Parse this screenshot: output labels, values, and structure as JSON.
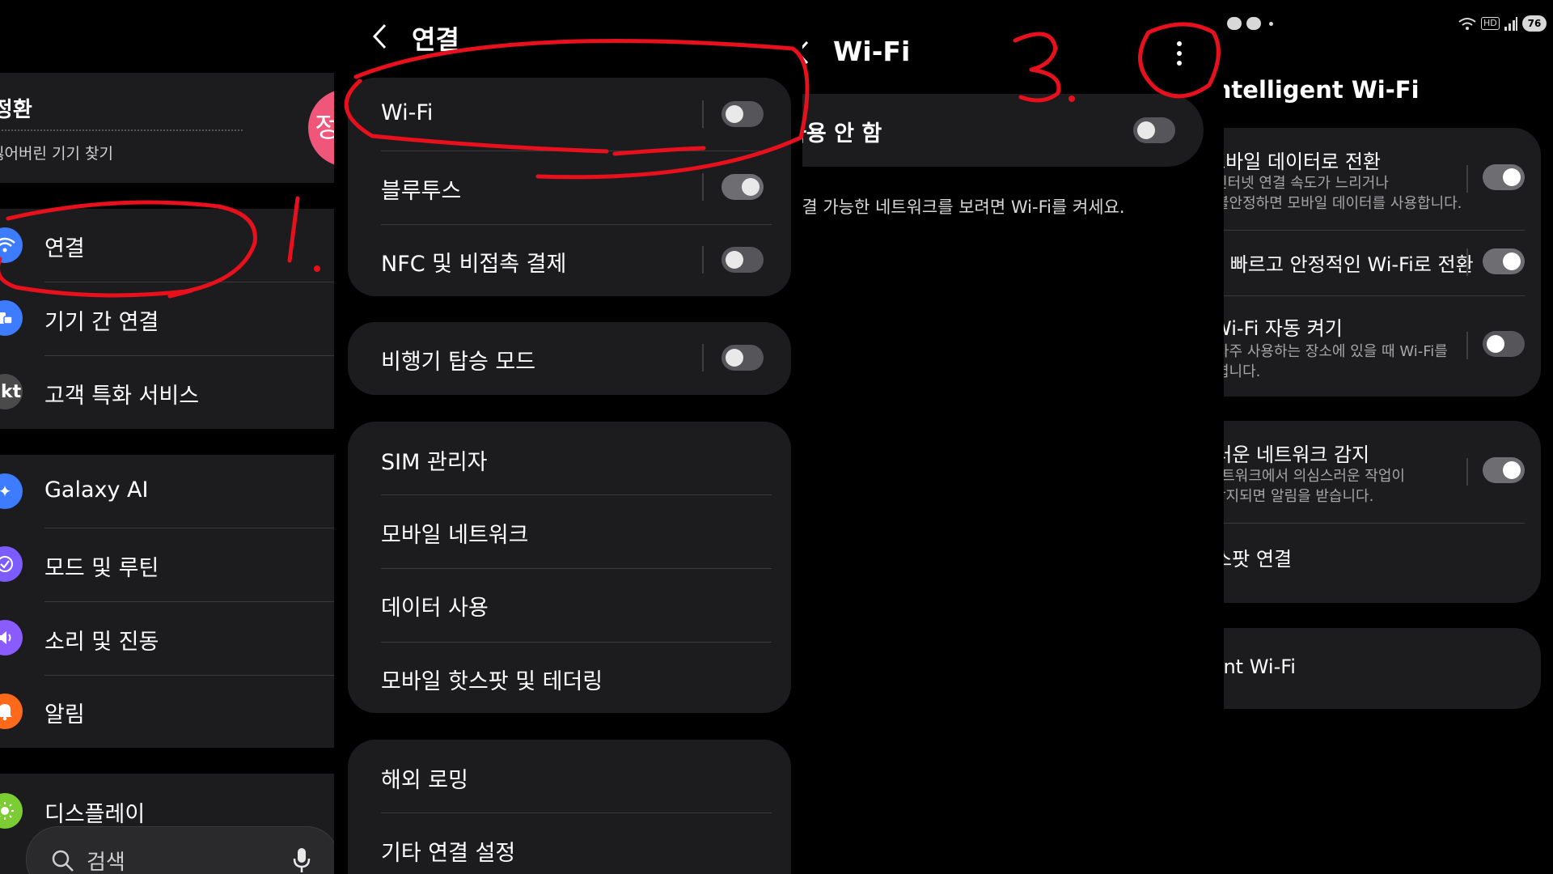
{
  "panel1": {
    "profile": {
      "name": "박정환",
      "subtitle": "잃어버린 기기 찾기",
      "avatar_letter": "정"
    },
    "menu": [
      {
        "label": "연결",
        "icon": "wifi-icon",
        "color": "#3d7bff"
      },
      {
        "label": "기기 간 연결",
        "icon": "devices-icon",
        "color": "#3d7bff"
      },
      {
        "label": "고객 특화 서비스",
        "icon": "kt-icon",
        "color": "#4a4a4a"
      },
      {
        "label": "Galaxy AI",
        "icon": "sparkle-icon",
        "color": "#3d7bff"
      },
      {
        "label": "모드 및 루틴",
        "icon": "routine-icon",
        "color": "#7c5cff"
      },
      {
        "label": "소리 및 진동",
        "icon": "sound-icon",
        "color": "#8a5cff"
      },
      {
        "label": "알림",
        "icon": "bell-icon",
        "color": "#ff6a1a"
      },
      {
        "label": "디스플레이",
        "icon": "brightness-icon",
        "color": "#7ccc33"
      }
    ],
    "search": {
      "placeholder": "검색"
    },
    "kt_glyph": "kt"
  },
  "panel2": {
    "title": "연결",
    "group1": [
      {
        "label": "Wi-Fi",
        "on": false
      },
      {
        "label": "블루투스",
        "on": true
      },
      {
        "label": "NFC 및 비접촉 결제",
        "on": false
      }
    ],
    "group2": [
      {
        "label": "비행기 탑승 모드",
        "on": false
      }
    ],
    "group3": [
      "SIM 관리자",
      "모바일 네트워크",
      "데이터 사용",
      "모바일 핫스팟 및 테더링"
    ],
    "group4": [
      "해외 로밍",
      "기타 연결 설정"
    ]
  },
  "panel3": {
    "title": "Wi-Fi",
    "toggle_label": "사용 안 함",
    "toggle_on": false,
    "info": "연결 가능한 네트워크를 보려면 Wi-Fi를 켜세요."
  },
  "panel4": {
    "title": "Intelligent Wi-Fi",
    "status_battery": "76",
    "status_hd": "HD",
    "items": [
      {
        "title": "모바일 데이터로 전환",
        "sub1": "인터넷 연결 속도가 느리거나",
        "sub2": "불안정하면 모바일 데이터를 사용합니다.",
        "on": true
      },
      {
        "title": "더 빠르고 안정적인 Wi-Fi로 전환",
        "on": true
      },
      {
        "title": "Wi-Fi 자동 켜기",
        "sub1": "자주 사용하는 장소에 있을 때 Wi-Fi를",
        "sub2": "켭니다.",
        "on": false
      },
      {
        "title": "의심스러운 네트워크 감지",
        "sub1": "Wi-Fi 네트워크에서 의심스러운 작업이",
        "sub2": "감지되면 알림을 받습니다.",
        "on": true
      },
      {
        "title": "핫스팟 연결"
      },
      {
        "title": "Intelligent Wi-Fi"
      }
    ]
  },
  "annotations": {
    "mark1": "1.",
    "mark3": "3."
  },
  "colors": {
    "background": "#000000",
    "card": "#1c1c1e",
    "annotation_red": "#e8101c"
  }
}
